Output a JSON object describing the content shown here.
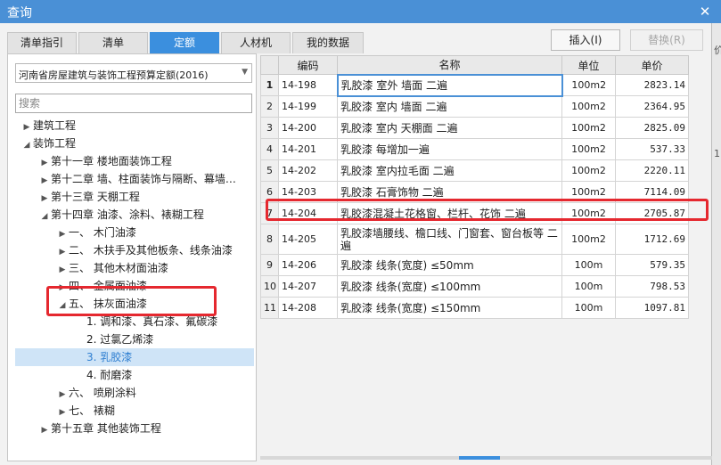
{
  "window": {
    "title": "查询",
    "close_glyph": "✕"
  },
  "tabs": [
    {
      "label": "清单指引",
      "active": false
    },
    {
      "label": "清单",
      "active": false
    },
    {
      "label": "定额",
      "active": true
    },
    {
      "label": "人材机",
      "active": false
    },
    {
      "label": "我的数据",
      "active": false
    }
  ],
  "actions": {
    "insert_label": "插入(I)",
    "replace_label": "替换(R)",
    "replace_enabled": false
  },
  "quota_library": {
    "selected": "河南省房屋建筑与装饰工程预算定额(2016)"
  },
  "search": {
    "placeholder": "搜索",
    "value": ""
  },
  "tree": [
    {
      "label": "建筑工程",
      "state": "collapsed",
      "level": 0
    },
    {
      "label": "装饰工程",
      "state": "expanded",
      "level": 0
    },
    {
      "label": "第十一章 楼地面装饰工程",
      "state": "collapsed",
      "level": 1
    },
    {
      "label": "第十二章 墙、柱面装饰与隔断、幕墙…",
      "state": "collapsed",
      "level": 1
    },
    {
      "label": "第十三章 天棚工程",
      "state": "collapsed",
      "level": 1
    },
    {
      "label": "第十四章 油漆、涂料、裱糊工程",
      "state": "expanded",
      "level": 1
    },
    {
      "label": "一、 木门油漆",
      "state": "collapsed",
      "level": 2
    },
    {
      "label": "二、 木扶手及其他板条、线条油漆",
      "state": "collapsed",
      "level": 2
    },
    {
      "label": "三、 其他木材面油漆",
      "state": "collapsed",
      "level": 2
    },
    {
      "label": "四、 金属面油漆",
      "state": "collapsed",
      "level": 2
    },
    {
      "label": "五、 抹灰面油漆",
      "state": "expanded",
      "level": 2
    },
    {
      "label": "1. 调和漆、真石漆、氟碳漆",
      "state": "leaf",
      "level": 3
    },
    {
      "label": "2. 过氯乙烯漆",
      "state": "leaf",
      "level": 3
    },
    {
      "label": "3. 乳胶漆",
      "state": "leaf",
      "level": 3,
      "selected": true
    },
    {
      "label": "4. 耐磨漆",
      "state": "leaf",
      "level": 3
    },
    {
      "label": "六、 喷刷涂料",
      "state": "collapsed",
      "level": 2
    },
    {
      "label": "七、 裱糊",
      "state": "collapsed",
      "level": 2
    },
    {
      "label": "第十五章 其他装饰工程",
      "state": "collapsed",
      "level": 1
    }
  ],
  "table": {
    "columns": [
      "编码",
      "名称",
      "单位",
      "单价"
    ],
    "current_row": 1,
    "rows": [
      {
        "n": "1",
        "code": "14-198",
        "name": "乳胶漆 室外 墙面 二遍",
        "unit": "100m2",
        "price": "2823.14"
      },
      {
        "n": "2",
        "code": "14-199",
        "name": "乳胶漆 室内 墙面 二遍",
        "unit": "100m2",
        "price": "2364.95"
      },
      {
        "n": "3",
        "code": "14-200",
        "name": "乳胶漆 室内 天棚面 二遍",
        "unit": "100m2",
        "price": "2825.09"
      },
      {
        "n": "4",
        "code": "14-201",
        "name": "乳胶漆 每增加一遍",
        "unit": "100m2",
        "price": "537.33"
      },
      {
        "n": "5",
        "code": "14-202",
        "name": "乳胶漆 室内拉毛面 二遍",
        "unit": "100m2",
        "price": "2220.11"
      },
      {
        "n": "6",
        "code": "14-203",
        "name": "乳胶漆 石膏饰物 二遍",
        "unit": "100m2",
        "price": "7114.09"
      },
      {
        "n": "7",
        "code": "14-204",
        "name": "乳胶漆混凝土花格窗、栏杆、花饰 二遍",
        "unit": "100m2",
        "price": "2705.87"
      },
      {
        "n": "8",
        "code": "14-205",
        "name": "乳胶漆墙腰线、檐口线、门窗套、窗台板等 二遍",
        "unit": "100m2",
        "price": "1712.69"
      },
      {
        "n": "9",
        "code": "14-206",
        "name": "乳胶漆 线条(宽度) ≤50mm",
        "unit": "100m",
        "price": "579.35"
      },
      {
        "n": "10",
        "code": "14-207",
        "name": "乳胶漆 线条(宽度) ≤100mm",
        "unit": "100m",
        "price": "798.53"
      },
      {
        "n": "11",
        "code": "14-208",
        "name": "乳胶漆 线条(宽度) ≤150mm",
        "unit": "100m",
        "price": "1097.81"
      }
    ]
  },
  "right_strip": {
    "t1": "价",
    "t2": "1"
  },
  "colors": {
    "accent": "#3b8fde",
    "highlight_box": "#e5282f",
    "title_bar": "#4a90d6"
  }
}
